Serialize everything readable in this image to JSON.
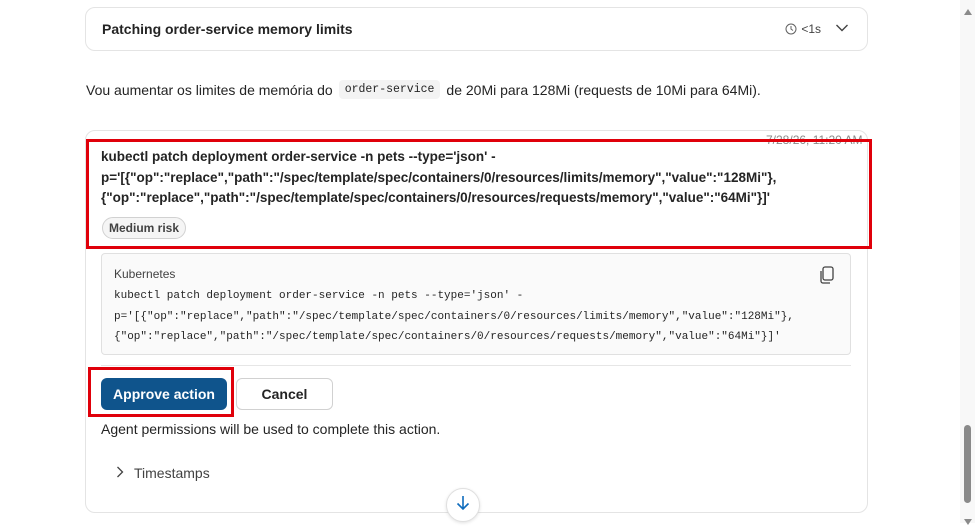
{
  "step": {
    "title": "Patching order-service memory limits",
    "duration": "<1s",
    "clock_icon": "clock-icon",
    "expand_icon": "chevron-down-icon"
  },
  "message": {
    "before": "Vou aumentar os limites de memória do",
    "code": "order-service",
    "after": "de 20Mi para 128Mi (requests de 10Mi para 64Mi)."
  },
  "action": {
    "timestamp": "7/28/26, 11:20 AM",
    "command_title": "kubectl patch deployment order-service -n pets --type='json' -\np='[{\"op\":\"replace\",\"path\":\"/spec/template/spec/containers/0/resources/limits/memory\",\"value\":\"128Mi\"},\n{\"op\":\"replace\",\"path\":\"/spec/template/spec/containers/0/resources/requests/memory\",\"value\":\"64Mi\"}]'",
    "risk": "Medium risk",
    "code_language": "Kubernetes",
    "code": "kubectl patch deployment order-service -n pets --type='json' -\np='[{\"op\":\"replace\",\"path\":\"/spec/template/spec/containers/0/resources/limits/memory\",\"value\":\"128Mi\"},\n{\"op\":\"replace\",\"path\":\"/spec/template/spec/containers/0/resources/requests/memory\",\"value\":\"64Mi\"}]'",
    "approve_label": "Approve action",
    "cancel_label": "Cancel",
    "permission_note": "Agent permissions will be used to complete this action.",
    "timestamps_label": "Timestamps"
  },
  "colors": {
    "primary": "#0f548c",
    "highlight": "#e0000a"
  }
}
